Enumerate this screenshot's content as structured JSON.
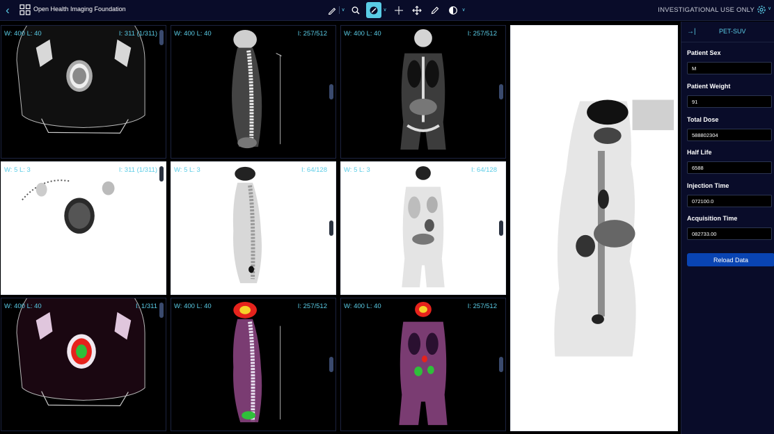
{
  "header": {
    "title": "Open Health Imaging Foundation",
    "notice": "INVESTIGATIONAL USE ONLY",
    "icons": [
      "back-chevron-icon",
      "logo-grid-icon",
      "gear-icon"
    ]
  },
  "toolbar": {
    "tools": [
      {
        "name": "measure-pencil",
        "icon": "pencil-icon"
      },
      {
        "name": "zoom",
        "icon": "magnifier-icon"
      },
      {
        "name": "window-level",
        "icon": "contrast-icon",
        "active": true
      },
      {
        "name": "crosshairs",
        "icon": "crosshair-icon"
      },
      {
        "name": "pan",
        "icon": "move-icon"
      },
      {
        "name": "annotate",
        "icon": "pen-icon"
      },
      {
        "name": "colormap",
        "icon": "half-circle-icon"
      }
    ],
    "accent_color": "#5acce6"
  },
  "viewports": [
    {
      "wl": "W: 400  L: 40",
      "index": "I: 311 (1/311)"
    },
    {
      "wl": "W: 400  L: 40",
      "index": "I: 257/512"
    },
    {
      "wl": "W: 400  L: 40",
      "index": "I: 257/512"
    },
    {
      "wl": "W: 5  L: 3",
      "index": "I: 311 (1/311)"
    },
    {
      "wl": "W: 5  L: 3",
      "index": "I: 64/128"
    },
    {
      "wl": "W: 5  L: 3",
      "index": "I: 64/128"
    },
    {
      "wl": "W: 400  L: 40",
      "index": "I: 1/311"
    },
    {
      "wl": "W: 400  L: 40",
      "index": "I: 257/512"
    },
    {
      "wl": "W: 400  L: 40",
      "index": "I: 257/512"
    }
  ],
  "panel": {
    "title": "PET-SUV",
    "fields": [
      {
        "label": "Patient Sex",
        "value": "M"
      },
      {
        "label": "Patient Weight",
        "value": "91"
      },
      {
        "label": "Total Dose",
        "value": "588802304"
      },
      {
        "label": "Half Life",
        "value": "6588"
      },
      {
        "label": "Injection Time",
        "value": "072100.0"
      },
      {
        "label": "Acquisition Time",
        "value": "082733.00"
      }
    ],
    "reload_label": "Reload Data",
    "button_color": "#0944b3"
  }
}
